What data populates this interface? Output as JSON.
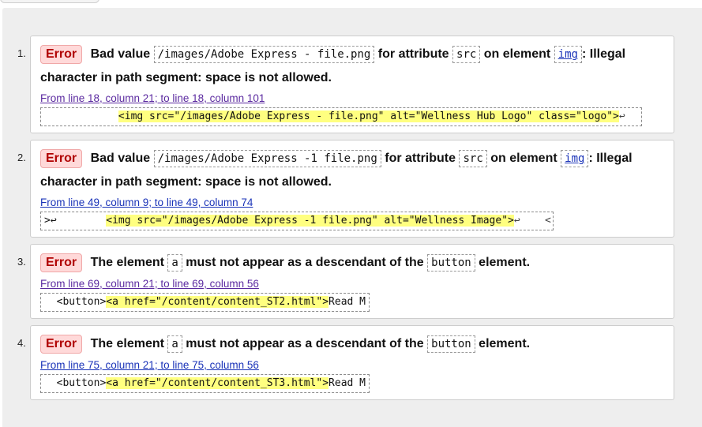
{
  "messages": [
    {
      "num": "1.",
      "badge": "Error",
      "text1": "Bad value",
      "code1": "/images/Adobe Express - file.png",
      "text2": "for attribute",
      "code2": "src",
      "text3": "on element",
      "code3": "img",
      "text4": ": Illegal character in path segment: space is not allowed.",
      "location": "From line 18, column 21; to line 18, column 101",
      "extract_pre": "            ",
      "extract_hl": "<img src=\"/images/Adobe Express - file.png\" alt=\"Wellness Hub Logo\" class=\"logo\">",
      "extract_post": "↩"
    },
    {
      "num": "2.",
      "badge": "Error",
      "text1": "Bad value",
      "code1": "/images/Adobe Express -1 file.png",
      "text2": "for attribute",
      "code2": "src",
      "text3": "on element",
      "code3": "img",
      "text4": ": Illegal character in path segment: space is not allowed.",
      "location": "From line 49, column 9; to line 49, column 74",
      "extract_pre": ">↩        ",
      "extract_hl": "<img src=\"/images/Adobe Express -1 file.png\" alt=\"Wellness Image\">",
      "extract_post": "↩    <"
    },
    {
      "num": "3.",
      "badge": "Error",
      "text1": "The element",
      "code1": "a",
      "text2": "must not appear as a descendant of the",
      "code2": "button",
      "text3": "element.",
      "location": "From line 69, column 21; to line 69, column 56",
      "extract_pre": "  <button>",
      "extract_hl": "<a href=\"/content/content_ST2.html\">",
      "extract_post": "Read M"
    },
    {
      "num": "4.",
      "badge": "Error",
      "text1": "The element",
      "code1": "a",
      "text2": "must not appear as a descendant of the",
      "code2": "button",
      "text3": "element.",
      "location": "From line 75, column 21; to line 75, column 56",
      "extract_pre": "  <button>",
      "extract_hl": "<a href=\"/content/content_ST3.html\">",
      "extract_post": "Read M"
    }
  ]
}
